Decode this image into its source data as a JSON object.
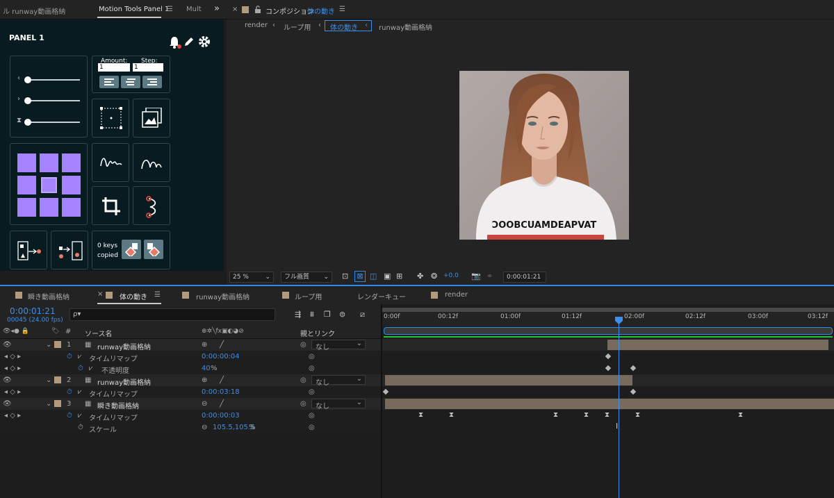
{
  "left_tabs": {
    "tab1": "ル runway動画格納",
    "tab2": "Motion Tools Panel 1",
    "tab3": "Mult",
    "expand": "»"
  },
  "motion_panel": {
    "title": "PANEL 1",
    "amount_label": "Amount:",
    "step_label": "Step:",
    "amount_value": "1",
    "step_value": "1",
    "keys_copied_count": "0 keys",
    "keys_copied_label": "copied"
  },
  "comp": {
    "title_prefix": "コンポジション",
    "title_name": "体の動き",
    "breadcrumb": [
      "render",
      "ループ用",
      "体の動き",
      "runway動画格納"
    ],
    "shirt_text": "ƆOOBCUAMDEAPVAT",
    "zoom": "25 %",
    "quality": "フル画質",
    "exposure": "+0.0",
    "timecode": "0:00:01:21"
  },
  "timeline": {
    "tabs": [
      "瞬き動画格納",
      "体の動き",
      "runway動画格納",
      "ループ用",
      "レンダーキュー",
      "render"
    ],
    "timecode": "0:00:01:21",
    "frames": "00045 (24.00 fps)",
    "search_placeholder": "ρ▾",
    "col_source": "ソース名",
    "col_parent": "親とリンク",
    "ruler": [
      "0:00f",
      "00:12f",
      "01:00f",
      "01:12f",
      "02:00f",
      "02:12f",
      "03:00f",
      "03:12f"
    ],
    "rows": [
      {
        "num": "1",
        "name": "runway動画格納",
        "parent": "なし"
      },
      {
        "prop": "タイムリマップ",
        "value": "0:00:00:04"
      },
      {
        "prop": "不透明度",
        "value": "40",
        "unit": "%"
      },
      {
        "num": "2",
        "name": "runway動画格納",
        "parent": "なし"
      },
      {
        "prop": "タイムリマップ",
        "value": "0:00:03:18"
      },
      {
        "num": "3",
        "name": "瞬き動画格納",
        "parent": "なし"
      },
      {
        "prop": "タイムリマップ",
        "value": "0:00:00:03"
      },
      {
        "prop": "スケール",
        "value": "105.5,105.5",
        "unit": "%"
      }
    ]
  },
  "colors": {
    "accent_blue": "#2d8ceb",
    "purple": "#a684ff",
    "panel_bg": "#081b20",
    "layer_bar": "#776b5d"
  }
}
